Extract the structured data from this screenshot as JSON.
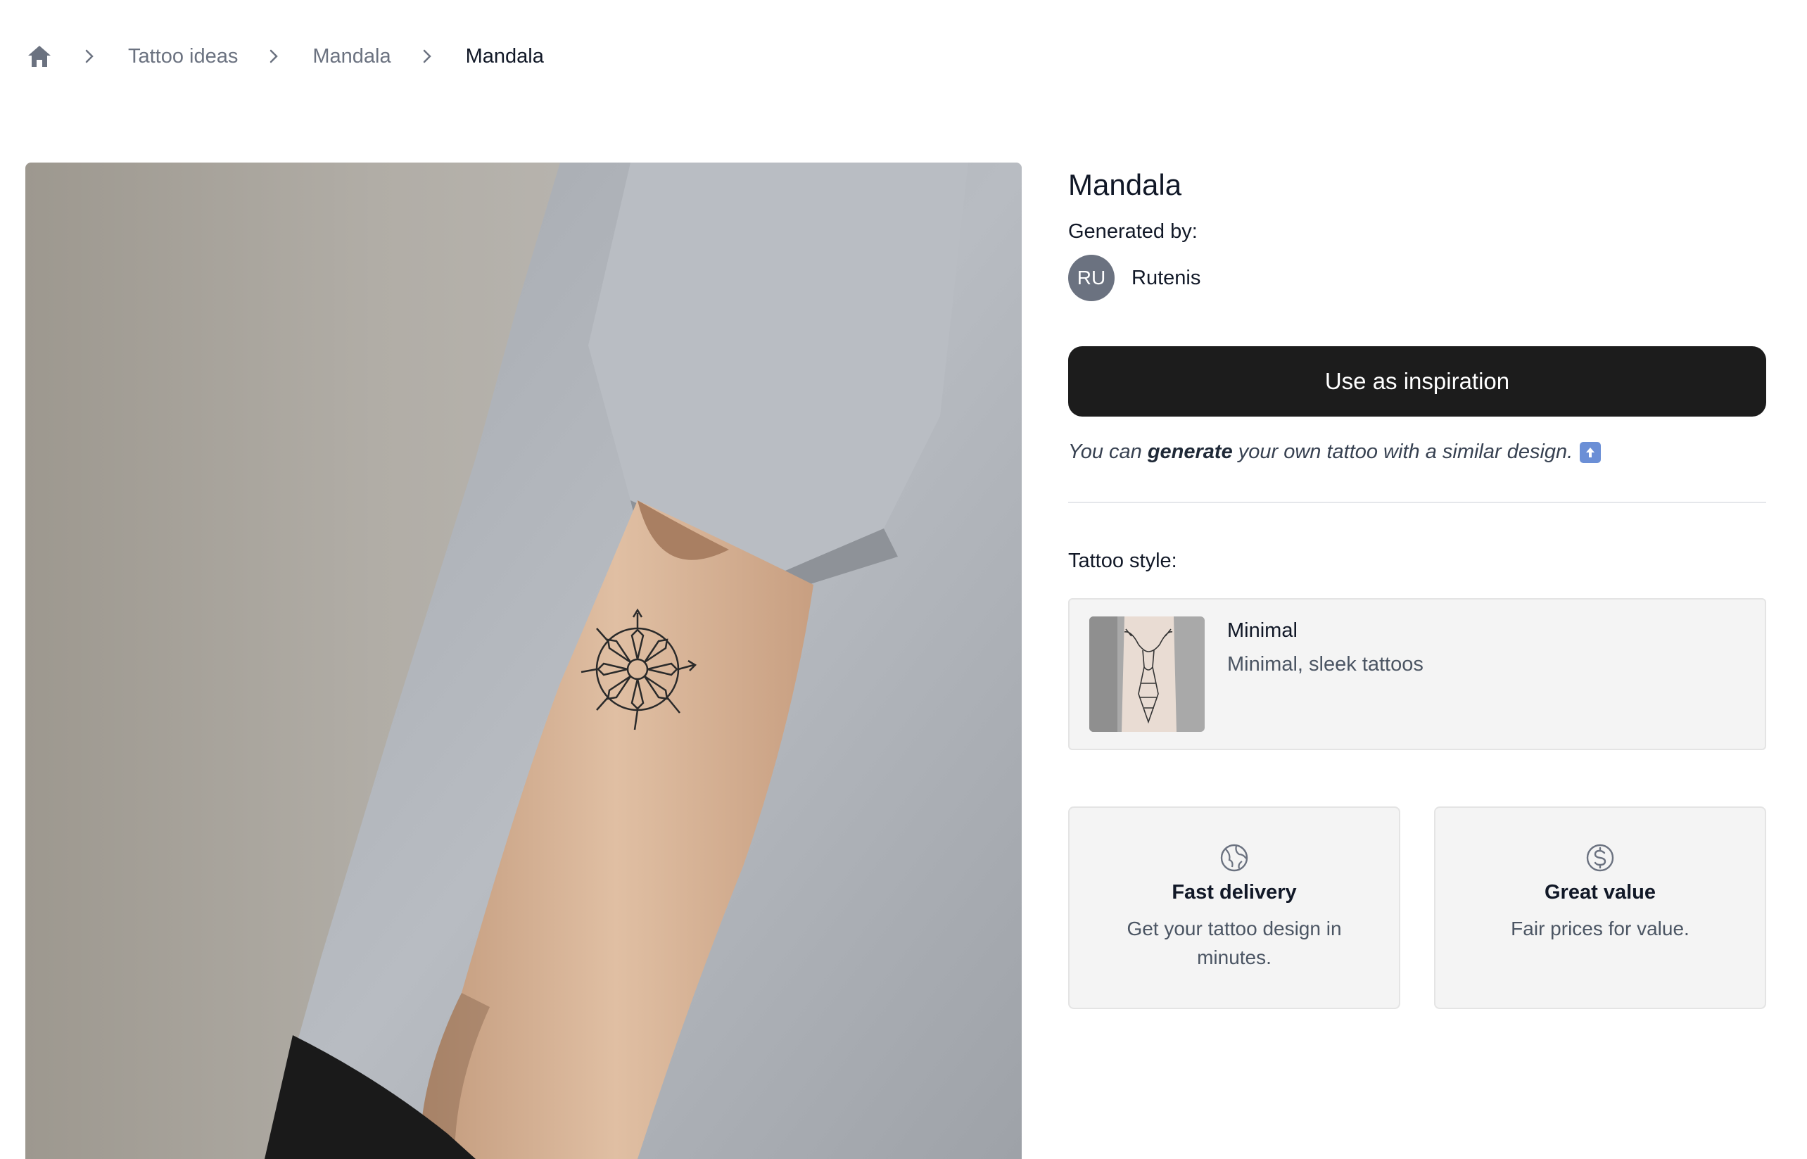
{
  "breadcrumb": {
    "home_icon": "home-icon",
    "separator_icon": "chevron-right-icon",
    "items": [
      "Tattoo ideas",
      "Mandala",
      "Mandala"
    ]
  },
  "photo": {
    "subject": "arm-with-mandala-tattoo-photo"
  },
  "panel": {
    "title": "Mandala",
    "generated_by_label": "Generated by:",
    "author_initials": "RU",
    "author_name": "Rutenis",
    "cta_label": "Use as inspiration",
    "hint_prefix": "You can",
    "hint_bold": "generate",
    "hint_suffix": "your own tattoo with a similar design.",
    "hint_icon": "arrow-up-emoji-icon",
    "tattoo_style_label": "Tattoo style:",
    "style": {
      "name": "Minimal",
      "description": "Minimal, sleek tattoos"
    },
    "features": [
      {
        "icon": "globe-icon",
        "title": "Fast delivery",
        "desc": "Get your tattoo design in minutes."
      },
      {
        "icon": "dollar-circle-icon",
        "title": "Great value",
        "desc": "Fair prices for value."
      }
    ]
  },
  "colors": {
    "cta_bg": "#1c1c1c",
    "avatar_bg": "#6b7280",
    "card_bg": "#f4f4f4",
    "muted_text": "#6b7280"
  }
}
